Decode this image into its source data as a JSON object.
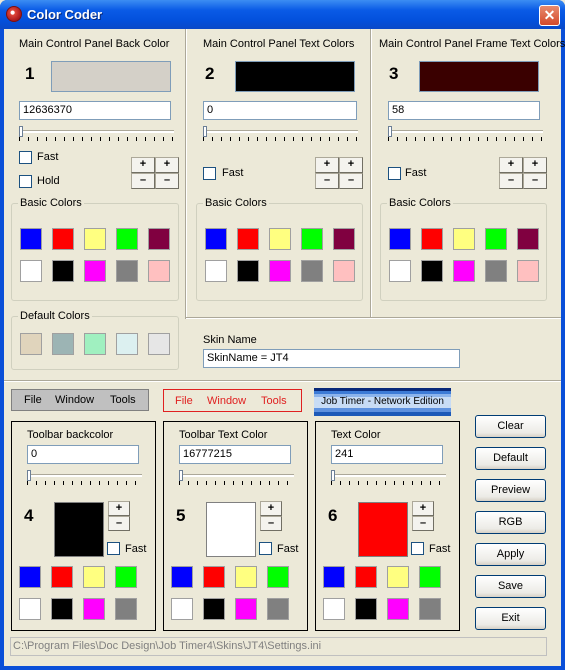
{
  "window": {
    "title": "Color Coder",
    "close_label": "✕"
  },
  "colors": {
    "blue": "#0000FF",
    "red": "#FF0000",
    "yellow": "#FFFF80",
    "green": "#00FF00",
    "maroon": "#800040",
    "white": "#FFFFFF",
    "black": "#000000",
    "magenta": "#FF00FF",
    "gray": "#808080",
    "pink": "#FFC0C0",
    "dflt1": "#E0D4BC",
    "dflt2": "#9CB4B4",
    "dflt3": "#A0F0C0",
    "dflt4": "#DCF0F0",
    "dflt5": "#E6E6E6"
  },
  "panel1": {
    "title": "Main Control Panel Back Color",
    "number": "1",
    "value": "12636370",
    "preview_color": "#D4D0C8",
    "fast_label": "Fast",
    "hold_label": "Hold",
    "basic_colors_label": "Basic Colors",
    "default_colors_label": "Default Colors"
  },
  "panel2": {
    "title": "Main Control Panel Text Colors",
    "number": "2",
    "value": "0",
    "preview_color": "#000000",
    "fast_label": "Fast",
    "basic_colors_label": "Basic Colors"
  },
  "panel3": {
    "title": "Main Control Panel Frame Text Colors",
    "number": "3",
    "value": "58",
    "preview_color": "#3A0000",
    "fast_label": "Fast",
    "basic_colors_label": "Basic Colors"
  },
  "skin": {
    "label": "Skin Name",
    "value": "SkinName = JT4"
  },
  "stepper": {
    "plus": "+",
    "minus": "–"
  },
  "menus": {
    "gray": [
      "File",
      "Window",
      "Tools"
    ],
    "red": [
      "File",
      "Window",
      "Tools"
    ],
    "banner": "Job Timer - Network Edition"
  },
  "panel4": {
    "title": "Toolbar backcolor",
    "number": "4",
    "value": "0",
    "preview_color": "#000000",
    "fast_label": "Fast"
  },
  "panel5": {
    "title": "Toolbar Text Color",
    "number": "5",
    "value": "16777215",
    "preview_color": "#FFFFFF",
    "fast_label": "Fast"
  },
  "panel6": {
    "title": "Text Color",
    "number": "6",
    "value": "241",
    "preview_color": "#FF0000",
    "fast_label": "Fast"
  },
  "buttons": [
    "Clear",
    "Default",
    "Preview",
    "RGB",
    "Apply",
    "Save",
    "Exit"
  ],
  "status": {
    "path": "C:\\Program Files\\Doc Design\\Job Timer4\\Skins\\JT4\\Settings.ini"
  }
}
